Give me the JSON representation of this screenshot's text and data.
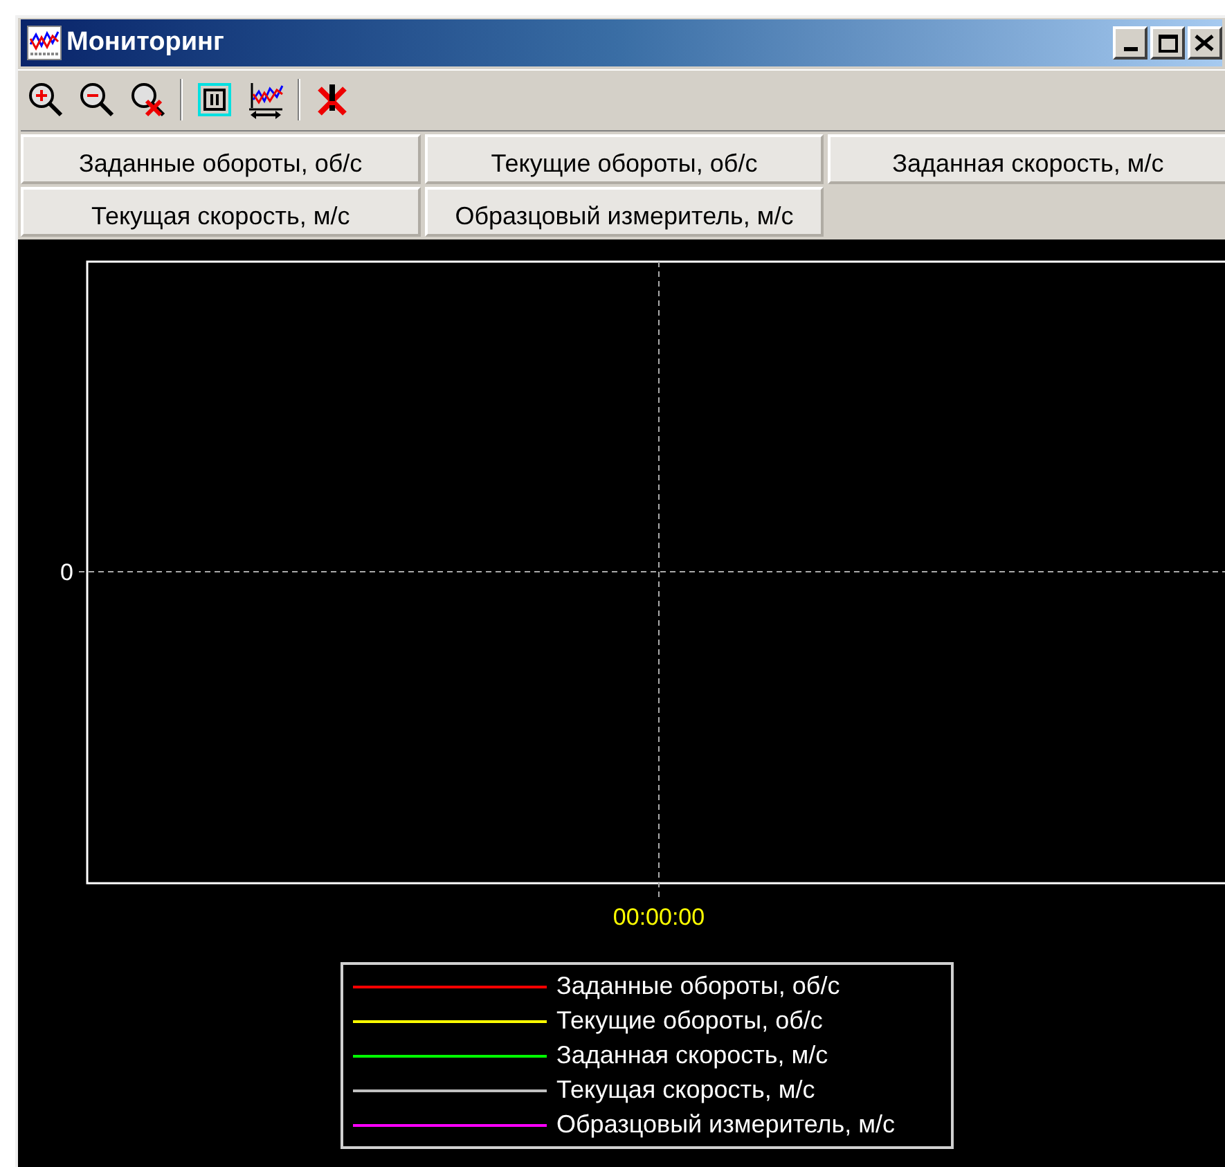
{
  "window": {
    "title": "Мониторинг"
  },
  "toolbar": [
    {
      "kind": "zoom-in"
    },
    {
      "kind": "zoom-out"
    },
    {
      "kind": "zoom-reset"
    },
    {
      "kind": "separator"
    },
    {
      "kind": "pause"
    },
    {
      "kind": "chart"
    },
    {
      "kind": "separator"
    },
    {
      "kind": "clear"
    }
  ],
  "channel_buttons": [
    {
      "label": "Заданные обороты, об/с"
    },
    {
      "label": "Текущие обороты, об/с"
    },
    {
      "label": "Заданная скорость, м/с"
    },
    {
      "label": "Текущая скорость, м/с"
    },
    {
      "label": "Образцовый измеритель, м/с"
    }
  ],
  "plot": {
    "y_tick": "0",
    "x_tick": "00:00:00"
  },
  "legend": [
    {
      "name": "Заданные обороты, об/с",
      "color": "#ff0000"
    },
    {
      "name": "Текущие обороты, об/с",
      "color": "#ffff00"
    },
    {
      "name": "Заданная скорость, м/с",
      "color": "#00ff00"
    },
    {
      "name": "Текущая скорость, м/с",
      "color": "#c0c0c0"
    },
    {
      "name": "Образцовый измеритель, м/с",
      "color": "#ff00ff"
    }
  ]
}
